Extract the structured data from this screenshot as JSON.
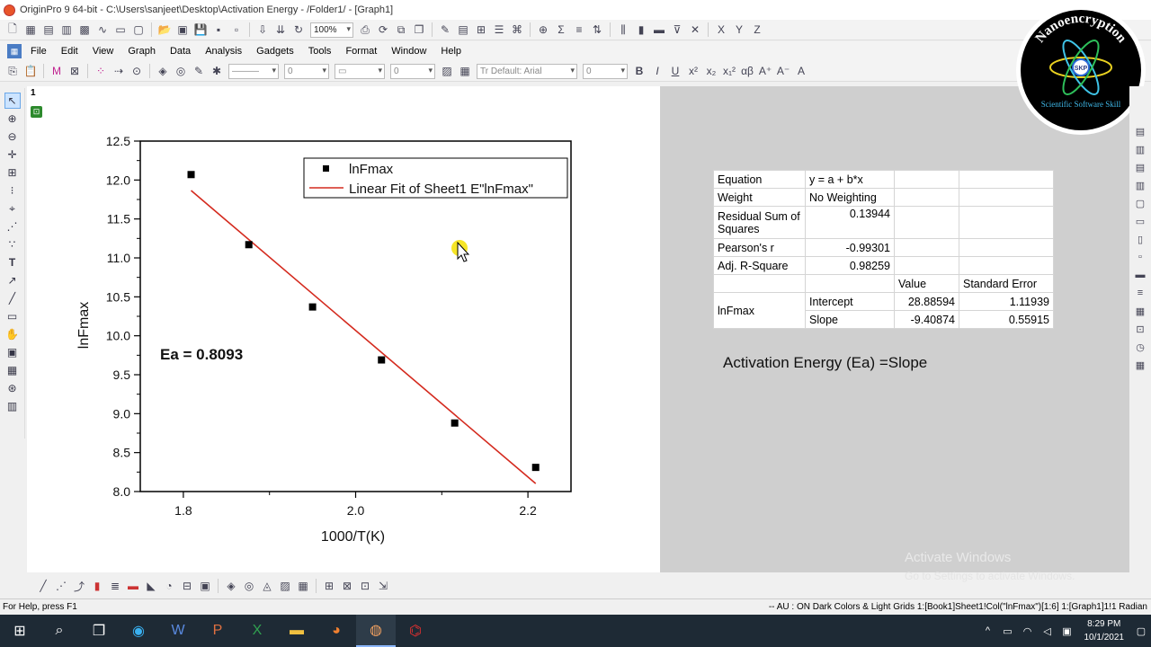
{
  "window": {
    "title": "OriginPro 9 64-bit - C:\\Users\\sanjeet\\Desktop\\Activation Energy - /Folder1/ - [Graph1]",
    "zoom": "100%"
  },
  "menu": [
    "File",
    "Edit",
    "View",
    "Graph",
    "Data",
    "Analysis",
    "Gadgets",
    "Tools",
    "Format",
    "Window",
    "Help"
  ],
  "format_toolbar": {
    "font_combo": "Tr Default: Arial",
    "size_combo": "0",
    "line_width": "0",
    "border_width": "0"
  },
  "page": {
    "tab": "1"
  },
  "chart_data": {
    "type": "scatter",
    "xlabel": "1000/T(K)",
    "ylabel": "lnFmax",
    "xlim": [
      1.75,
      2.25
    ],
    "ylim": [
      8.0,
      12.5
    ],
    "xticks": [
      "1.8",
      "2.0",
      "2.2"
    ],
    "yticks": [
      "8.0",
      "8.5",
      "9.0",
      "9.5",
      "10.0",
      "10.5",
      "11.0",
      "11.5",
      "12.0",
      "12.5"
    ],
    "series": [
      {
        "name": "lnFmax",
        "kind": "scatter",
        "color": "#000000",
        "x": [
          1.809,
          1.876,
          1.95,
          2.03,
          2.115,
          2.209
        ],
        "y": [
          12.07,
          11.17,
          10.37,
          9.69,
          8.88,
          8.31
        ]
      },
      {
        "name": "Linear Fit of Sheet1 E\"lnFmax\"",
        "kind": "line",
        "color": "#d42a1e",
        "intercept": 28.88594,
        "slope": -9.40874,
        "x_range": [
          1.809,
          2.209
        ]
      }
    ],
    "annotation": "Ea = 0.8093",
    "legend_position": "top-right"
  },
  "results_table": {
    "equation_label": "Equation",
    "equation_value": "y = a + b*x",
    "weight_label": "Weight",
    "weight_value": "No Weighting",
    "rss_label": "Residual Sum of Squares",
    "rss_value": "0.13944",
    "pearson_label": "Pearson's r",
    "pearson_value": "-0.99301",
    "adjr_label": "Adj. R-Square",
    "adjr_value": "0.98259",
    "col_value": "Value",
    "col_stderr": "Standard Error",
    "param_group": "lnFmax",
    "intercept_label": "Intercept",
    "intercept_value": "28.88594",
    "intercept_err": "1.11939",
    "slope_label": "Slope",
    "slope_value": "-9.40874",
    "slope_err": "0.55915"
  },
  "activation_text": "Activation Energy (Ea) =Slope",
  "watermark": {
    "line1": "Activate Windows",
    "line2": "Go to Settings to activate Windows."
  },
  "logo": {
    "text": "Nanoencryption",
    "badge": "SKP",
    "subtitle": "Scientific Software Skill"
  },
  "status": {
    "help": "For Help, press F1",
    "right": "-- AU : ON  Dark Colors & Light Grids  1:[Book1]Sheet1!Col(\"lnFmax\")[1:6]  1:[Graph1]1!1  Radian"
  },
  "taskbar": {
    "time": "8:29 PM",
    "date": "10/1/2021"
  }
}
